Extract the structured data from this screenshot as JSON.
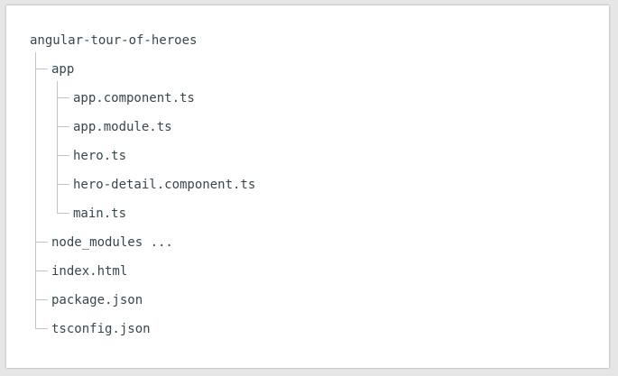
{
  "tree": {
    "root": "angular-tour-of-heroes",
    "app_folder": "app",
    "app_files": [
      "app.component.ts",
      "app.module.ts",
      "hero.ts",
      "hero-detail.component.ts",
      "main.ts"
    ],
    "root_items": [
      "node_modules ...",
      "index.html",
      "package.json",
      "tsconfig.json"
    ]
  },
  "colors": {
    "text": "#37474f",
    "connector": "#c4c4c4",
    "panel": "#ffffff",
    "background": "#e6e6e6"
  }
}
